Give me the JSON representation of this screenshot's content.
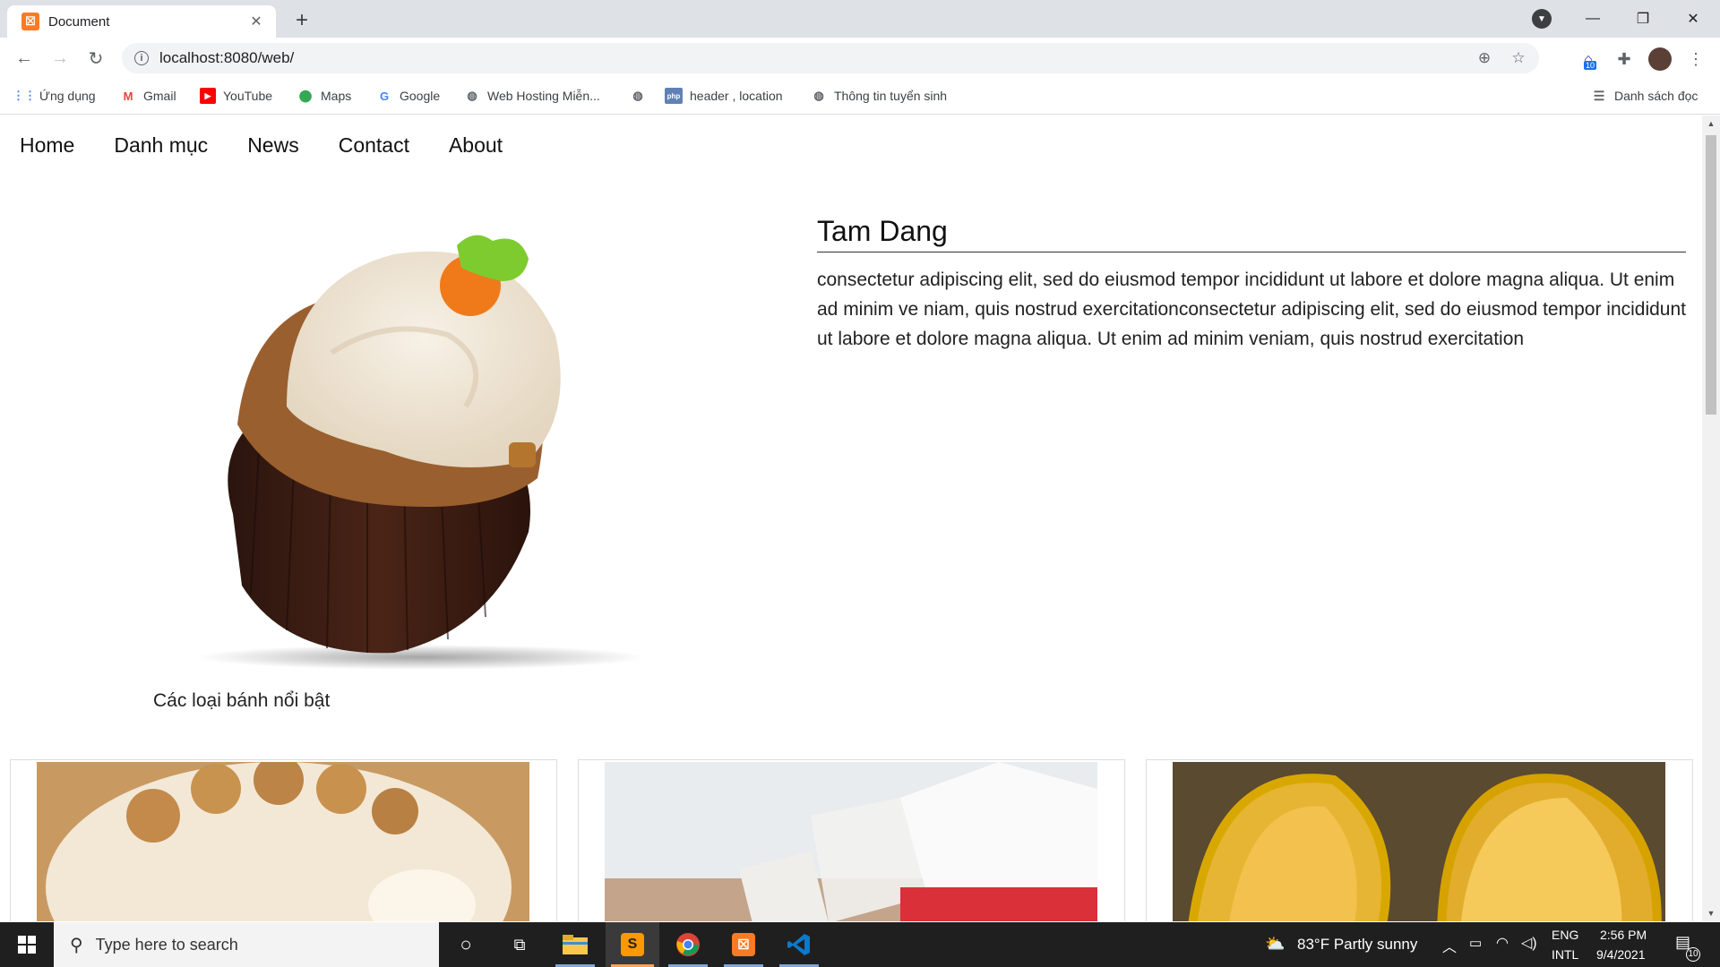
{
  "browser": {
    "tab_title": "Document",
    "url": "localhost:8080/web/",
    "bookmarks": [
      {
        "label": "Ứng dụng",
        "icon": "apps-grid-icon"
      },
      {
        "label": "Gmail",
        "icon": "gmail-icon"
      },
      {
        "label": "YouTube",
        "icon": "youtube-icon"
      },
      {
        "label": "Maps",
        "icon": "maps-pin-icon"
      },
      {
        "label": "Google",
        "icon": "google-icon"
      },
      {
        "label": "Web Hosting Miễn...",
        "icon": "globe-icon"
      },
      {
        "label": "",
        "icon": "globe-icon"
      },
      {
        "label": "header , location",
        "icon": "php-icon"
      },
      {
        "label": "Thông tin tuyển sinh",
        "icon": "globe-icon"
      }
    ],
    "reading_list": "Danh sách đọc",
    "extension_badge": "10"
  },
  "site": {
    "nav": [
      "Home",
      "Danh mục",
      "News",
      "Contact",
      "About"
    ],
    "hero_caption": "Các loại bánh nổi bật",
    "profile_name": "Tam Dang",
    "profile_text": "consectetur adipiscing elit, sed do eiusmod tempor incididunt ut labore et dolore magna aliqua. Ut enim ad minim ve niam, quis nostrud exercitationconsectetur adipiscing elit, sed do eiusmod tempor incididunt ut labore et dolore magna aliqua. Ut enim ad minim veniam, quis nostrud exercitation"
  },
  "taskbar": {
    "search_placeholder": "Type here to search",
    "weather": "83°F  Partly sunny",
    "lang_top": "ENG",
    "lang_bottom": "INTL",
    "time": "2:56 PM",
    "date": "9/4/2021",
    "notification_count": "10"
  },
  "colors": {
    "xampp_orange": "#fb7a24",
    "sublime_orange": "#ff9800",
    "vscode_blue": "#0a7acc"
  }
}
